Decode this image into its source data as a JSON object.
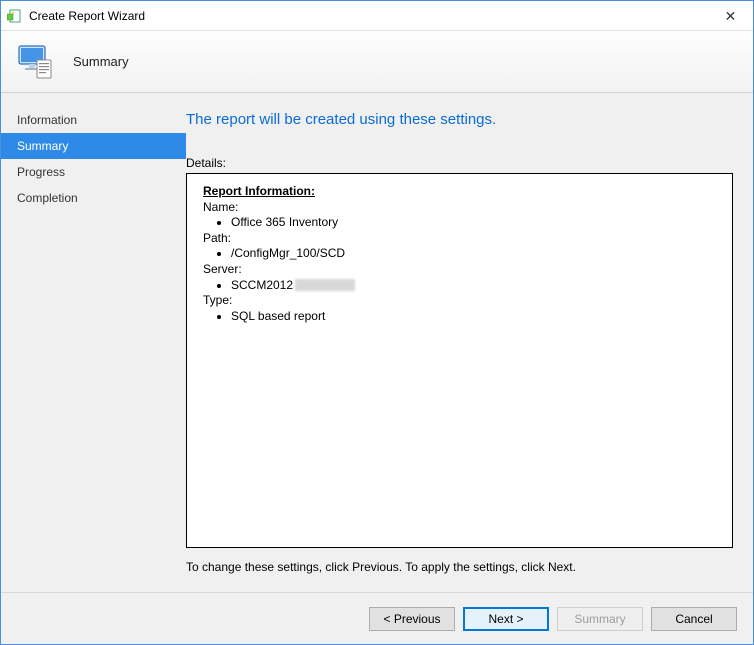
{
  "window": {
    "title": "Create Report Wizard",
    "close_glyph": "✕"
  },
  "header": {
    "page_title": "Summary"
  },
  "sidebar": {
    "items": [
      {
        "label": "Information",
        "active": false
      },
      {
        "label": "Summary",
        "active": true
      },
      {
        "label": "Progress",
        "active": false
      },
      {
        "label": "Completion",
        "active": false
      }
    ]
  },
  "content": {
    "headline": "The report will be created using these settings.",
    "details_label": "Details:",
    "report": {
      "section_title": "Report Information:",
      "name_label": "Name:",
      "name_value": "Office 365 Inventory",
      "path_label": "Path:",
      "path_value": "/ConfigMgr_100/SCD",
      "server_label": "Server:",
      "server_value": "SCCM2012",
      "server_redacted": true,
      "type_label": "Type:",
      "type_value": "SQL based report"
    },
    "hint": "To change these settings, click Previous. To apply the settings, click Next."
  },
  "footer": {
    "previous_label": "< Previous",
    "next_label": "Next >",
    "summary_label": "Summary",
    "cancel_label": "Cancel"
  }
}
